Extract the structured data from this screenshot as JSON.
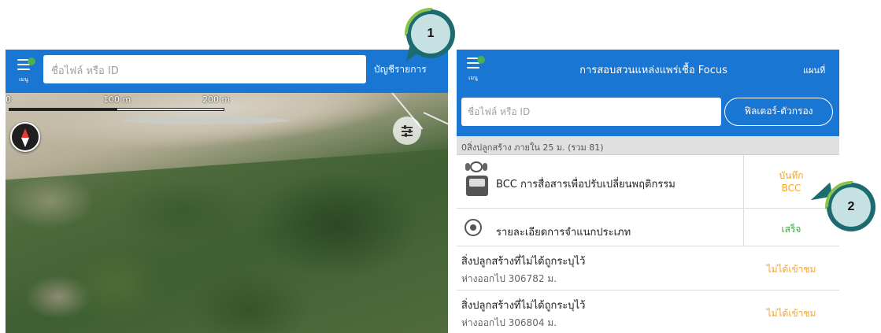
{
  "callouts": [
    "1",
    "2"
  ],
  "left_panel": {
    "menu_label": "เมนู",
    "search_placeholder": "ชื่อไฟล์ หรือ ID",
    "list_link": "บัญชีรายการ",
    "scale": {
      "zero": "0",
      "mid": "100 m",
      "end": "200 m"
    },
    "icons": {
      "compass": "compass-icon",
      "filter": "sliders-icon",
      "menu": "hamburger-menu-icon"
    },
    "colors": {
      "topbar": "#1976d2",
      "menu_status_dot": "#4caf50"
    }
  },
  "right_panel": {
    "menu_label": "เมนู",
    "title": "การสอบสวนแหล่งแพร่เชื้อ Focus",
    "map_link": "แผนที่",
    "search_placeholder": "ชื่อไฟล์ หรือ ID",
    "filter_button": "ฟิลเตอร์-ตัวกรอง",
    "summary": "0สิ่งปลูกสร้าง ภายใน 25 ม. (รวม 81)",
    "rows": [
      {
        "label": "BCC การสื่อสารเพื่อปรับเปลี่ยนพฤติกรรม",
        "status": "บันทึก\nBCC",
        "status_color": "#f5a623",
        "icon": "bcc-robot-icon"
      },
      {
        "label": "รายละเอียดการจำแนกประเภท",
        "status": "เสร็จ",
        "status_color": "#43a047",
        "icon": "target-icon"
      },
      {
        "label": "สิ่งปลูกสร้างที่ไม่ได้ถูกระบุไว้",
        "sub": "ห่างออกไป 306782 ม.",
        "status": "ไม่ได้เข้าชม",
        "status_color": "#f5a623"
      },
      {
        "label": "สิ่งปลูกสร้างที่ไม่ได้ถูกระบุไว้",
        "sub": "ห่างออกไป 306804 ม.",
        "status": "ไม่ได้เข้าชม",
        "status_color": "#f5a623"
      }
    ]
  }
}
